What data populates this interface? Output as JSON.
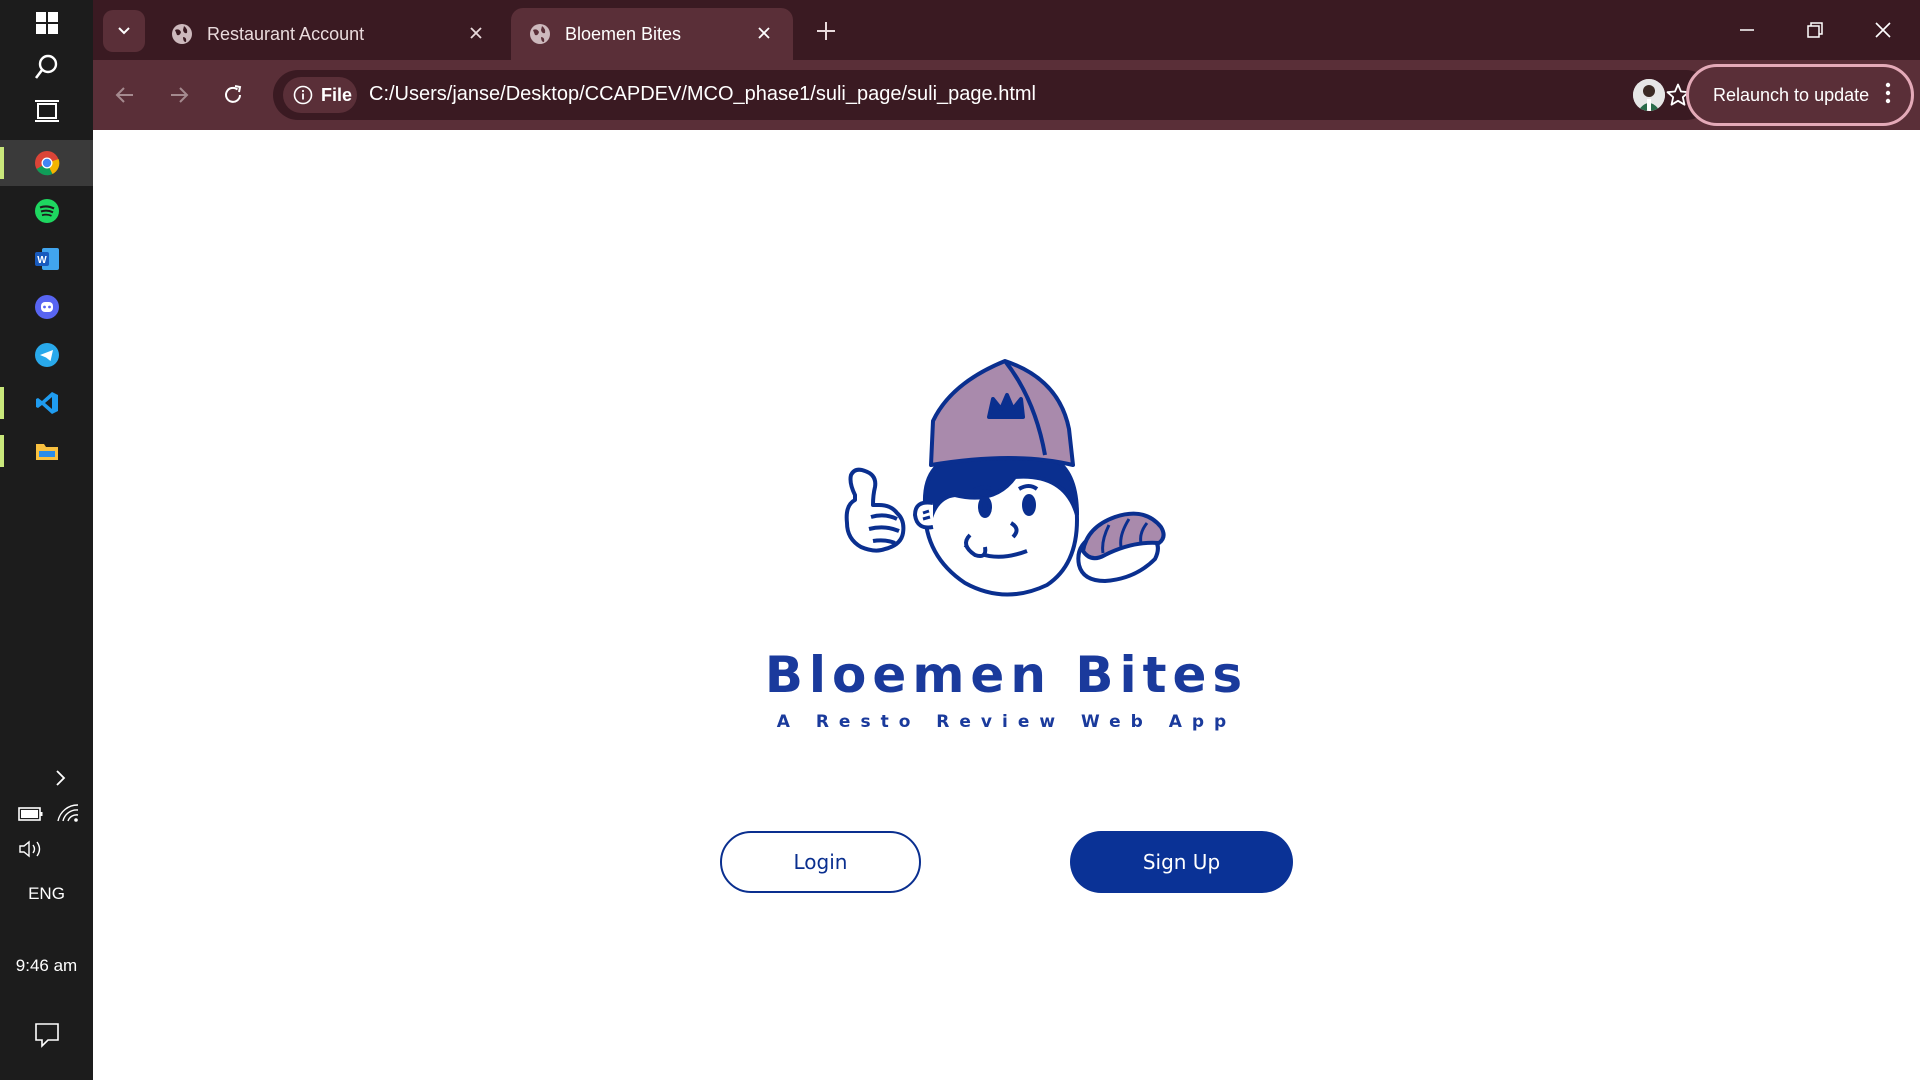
{
  "taskbar": {
    "icons": [
      "windows-start-icon",
      "search-icon",
      "task-view-icon",
      "chrome-icon",
      "spotify-icon",
      "word-icon",
      "discord-icon",
      "telegram-icon",
      "vscode-icon",
      "file-explorer-icon"
    ],
    "tray": {
      "language": "ENG",
      "time": "9:46 am"
    }
  },
  "browser": {
    "tabs": [
      {
        "title": "Restaurant Account",
        "active": false
      },
      {
        "title": "Bloemen Bites",
        "active": true
      }
    ],
    "chip_label": "File",
    "url": "C:/Users/janse/Desktop/CCAPDEV/MCO_phase1/suli_page/suli_page.html",
    "relaunch_label": "Relaunch to update",
    "colors": {
      "frame": "#3a1a22",
      "toolbar": "#5a2f38",
      "relaunch_border": "#e4aab8"
    }
  },
  "page": {
    "brand_title": "Bloemen Bites",
    "brand_subtitle": "A Resto Review Web App",
    "login_label": "Login",
    "signup_label": "Sign Up",
    "colors": {
      "brand_blue": "#0a3296",
      "cap_mauve": "#a98aac"
    }
  }
}
